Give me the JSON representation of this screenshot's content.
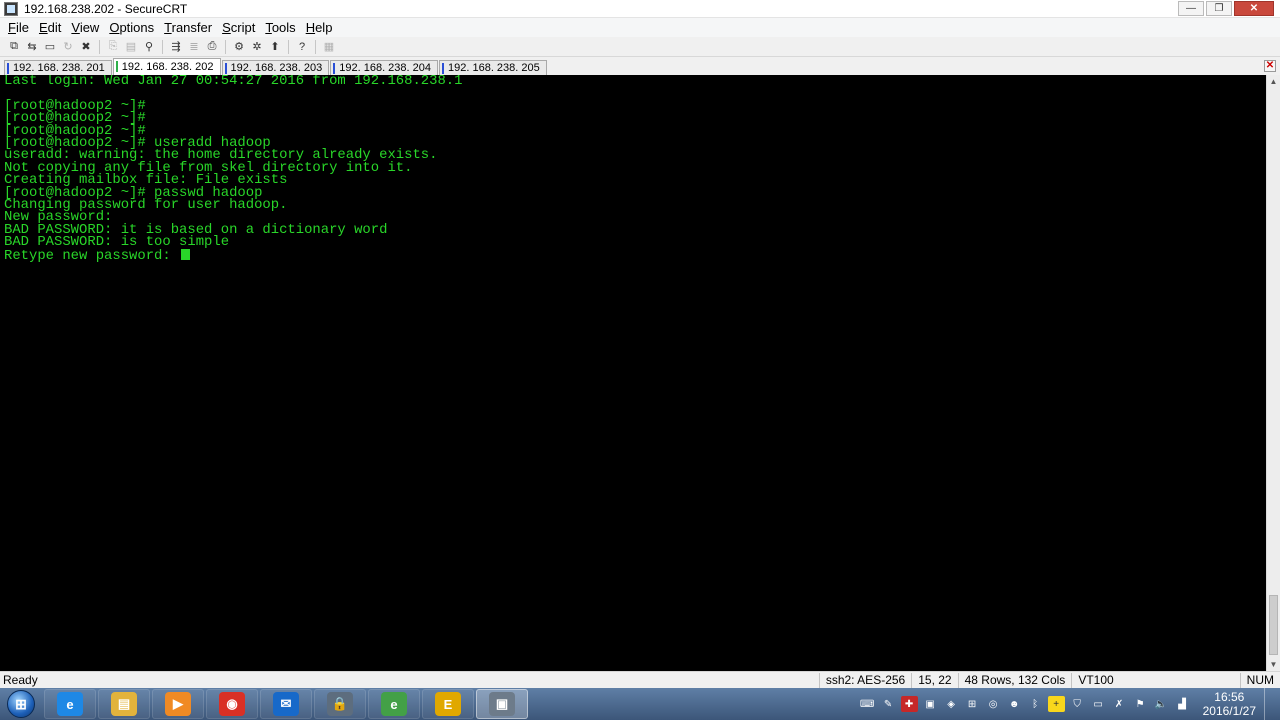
{
  "window": {
    "title": "192.168.238.202 - SecureCRT"
  },
  "menu": {
    "items": [
      {
        "label": "File",
        "underline": "F",
        "rest": "ile"
      },
      {
        "label": "Edit",
        "underline": "E",
        "rest": "dit"
      },
      {
        "label": "View",
        "underline": "V",
        "rest": "iew"
      },
      {
        "label": "Options",
        "underline": "O",
        "rest": "ptions"
      },
      {
        "label": "Transfer",
        "underline": "T",
        "rest": "ransfer"
      },
      {
        "label": "Script",
        "underline": "S",
        "rest": "cript"
      },
      {
        "label": "Tools",
        "underline": "T",
        "rest": "ools"
      },
      {
        "label": "Help",
        "underline": "H",
        "rest": "elp"
      }
    ]
  },
  "tabs": [
    {
      "label": "192. 168. 238. 201",
      "active": false
    },
    {
      "label": "192. 168. 238. 202",
      "active": true
    },
    {
      "label": "192. 168. 238. 203",
      "active": false
    },
    {
      "label": "192. 168. 238. 204",
      "active": false
    },
    {
      "label": "192. 168. 238. 205",
      "active": false
    }
  ],
  "terminal": {
    "lines": [
      "Last login: Wed Jan 27 00:54:27 2016 from 192.168.238.1",
      "",
      "[root@hadoop2 ~]#",
      "[root@hadoop2 ~]#",
      "[root@hadoop2 ~]#",
      "[root@hadoop2 ~]# useradd hadoop",
      "useradd: warning: the home directory already exists.",
      "Not copying any file from skel directory into it.",
      "Creating mailbox file: File exists",
      "[root@hadoop2 ~]# passwd hadoop",
      "Changing password for user hadoop.",
      "New password:",
      "BAD PASSWORD: it is based on a dictionary word",
      "BAD PASSWORD: is too simple"
    ],
    "prompt_line": "Retype new password: ",
    "text_color": "#29d629",
    "background": "#000000"
  },
  "status": {
    "ready": "Ready",
    "cipher": "ssh2: AES-256",
    "position": "15,  22",
    "size": "48 Rows, 132 Cols",
    "emulation": "VT100",
    "numlock": "NUM"
  },
  "taskbar": {
    "apps": [
      {
        "name": "internet-explorer-icon",
        "glyph": "e",
        "color": "#1e88e5",
        "active": false
      },
      {
        "name": "file-explorer-icon",
        "glyph": "▤",
        "color": "#e2b33c",
        "active": false
      },
      {
        "name": "media-player-icon",
        "glyph": "▶",
        "color": "#f08a24",
        "active": false
      },
      {
        "name": "chrome-icon",
        "glyph": "◉",
        "color": "#d93025",
        "active": false
      },
      {
        "name": "outlook-icon",
        "glyph": "✉",
        "color": "#1769c9",
        "active": false
      },
      {
        "name": "security-app-icon",
        "glyph": "🔒",
        "color": "#5d6d7e",
        "active": false
      },
      {
        "name": "ie-green-icon",
        "glyph": "e",
        "color": "#43a047",
        "active": false
      },
      {
        "name": "e-app-icon",
        "glyph": "E",
        "color": "#e0a800",
        "active": false
      },
      {
        "name": "securecrt-icon",
        "glyph": "▣",
        "color": "#6d7b8a",
        "active": true
      }
    ],
    "clock_time": "16:56",
    "clock_date": "2016/1/27"
  }
}
